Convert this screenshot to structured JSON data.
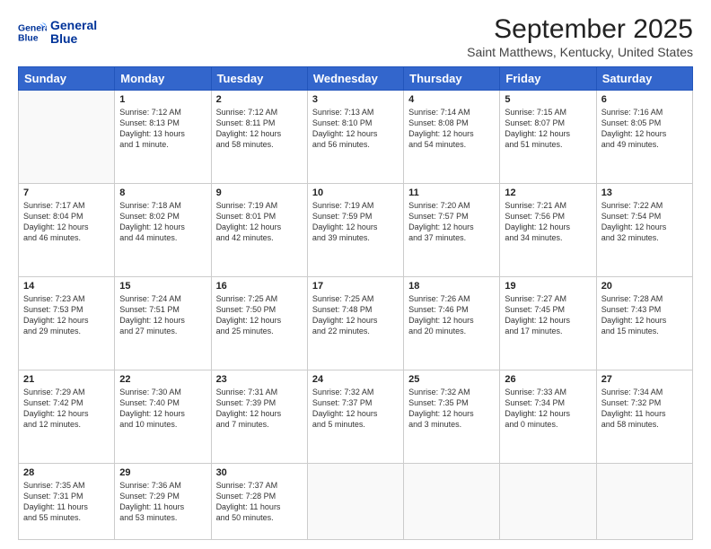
{
  "header": {
    "logo_line1": "General",
    "logo_line2": "Blue",
    "title": "September 2025",
    "subtitle": "Saint Matthews, Kentucky, United States"
  },
  "days_of_week": [
    "Sunday",
    "Monday",
    "Tuesday",
    "Wednesday",
    "Thursday",
    "Friday",
    "Saturday"
  ],
  "weeks": [
    [
      {
        "day": "",
        "lines": []
      },
      {
        "day": "1",
        "lines": [
          "Sunrise: 7:12 AM",
          "Sunset: 8:13 PM",
          "Daylight: 13 hours",
          "and 1 minute."
        ]
      },
      {
        "day": "2",
        "lines": [
          "Sunrise: 7:12 AM",
          "Sunset: 8:11 PM",
          "Daylight: 12 hours",
          "and 58 minutes."
        ]
      },
      {
        "day": "3",
        "lines": [
          "Sunrise: 7:13 AM",
          "Sunset: 8:10 PM",
          "Daylight: 12 hours",
          "and 56 minutes."
        ]
      },
      {
        "day": "4",
        "lines": [
          "Sunrise: 7:14 AM",
          "Sunset: 8:08 PM",
          "Daylight: 12 hours",
          "and 54 minutes."
        ]
      },
      {
        "day": "5",
        "lines": [
          "Sunrise: 7:15 AM",
          "Sunset: 8:07 PM",
          "Daylight: 12 hours",
          "and 51 minutes."
        ]
      },
      {
        "day": "6",
        "lines": [
          "Sunrise: 7:16 AM",
          "Sunset: 8:05 PM",
          "Daylight: 12 hours",
          "and 49 minutes."
        ]
      }
    ],
    [
      {
        "day": "7",
        "lines": [
          "Sunrise: 7:17 AM",
          "Sunset: 8:04 PM",
          "Daylight: 12 hours",
          "and 46 minutes."
        ]
      },
      {
        "day": "8",
        "lines": [
          "Sunrise: 7:18 AM",
          "Sunset: 8:02 PM",
          "Daylight: 12 hours",
          "and 44 minutes."
        ]
      },
      {
        "day": "9",
        "lines": [
          "Sunrise: 7:19 AM",
          "Sunset: 8:01 PM",
          "Daylight: 12 hours",
          "and 42 minutes."
        ]
      },
      {
        "day": "10",
        "lines": [
          "Sunrise: 7:19 AM",
          "Sunset: 7:59 PM",
          "Daylight: 12 hours",
          "and 39 minutes."
        ]
      },
      {
        "day": "11",
        "lines": [
          "Sunrise: 7:20 AM",
          "Sunset: 7:57 PM",
          "Daylight: 12 hours",
          "and 37 minutes."
        ]
      },
      {
        "day": "12",
        "lines": [
          "Sunrise: 7:21 AM",
          "Sunset: 7:56 PM",
          "Daylight: 12 hours",
          "and 34 minutes."
        ]
      },
      {
        "day": "13",
        "lines": [
          "Sunrise: 7:22 AM",
          "Sunset: 7:54 PM",
          "Daylight: 12 hours",
          "and 32 minutes."
        ]
      }
    ],
    [
      {
        "day": "14",
        "lines": [
          "Sunrise: 7:23 AM",
          "Sunset: 7:53 PM",
          "Daylight: 12 hours",
          "and 29 minutes."
        ]
      },
      {
        "day": "15",
        "lines": [
          "Sunrise: 7:24 AM",
          "Sunset: 7:51 PM",
          "Daylight: 12 hours",
          "and 27 minutes."
        ]
      },
      {
        "day": "16",
        "lines": [
          "Sunrise: 7:25 AM",
          "Sunset: 7:50 PM",
          "Daylight: 12 hours",
          "and 25 minutes."
        ]
      },
      {
        "day": "17",
        "lines": [
          "Sunrise: 7:25 AM",
          "Sunset: 7:48 PM",
          "Daylight: 12 hours",
          "and 22 minutes."
        ]
      },
      {
        "day": "18",
        "lines": [
          "Sunrise: 7:26 AM",
          "Sunset: 7:46 PM",
          "Daylight: 12 hours",
          "and 20 minutes."
        ]
      },
      {
        "day": "19",
        "lines": [
          "Sunrise: 7:27 AM",
          "Sunset: 7:45 PM",
          "Daylight: 12 hours",
          "and 17 minutes."
        ]
      },
      {
        "day": "20",
        "lines": [
          "Sunrise: 7:28 AM",
          "Sunset: 7:43 PM",
          "Daylight: 12 hours",
          "and 15 minutes."
        ]
      }
    ],
    [
      {
        "day": "21",
        "lines": [
          "Sunrise: 7:29 AM",
          "Sunset: 7:42 PM",
          "Daylight: 12 hours",
          "and 12 minutes."
        ]
      },
      {
        "day": "22",
        "lines": [
          "Sunrise: 7:30 AM",
          "Sunset: 7:40 PM",
          "Daylight: 12 hours",
          "and 10 minutes."
        ]
      },
      {
        "day": "23",
        "lines": [
          "Sunrise: 7:31 AM",
          "Sunset: 7:39 PM",
          "Daylight: 12 hours",
          "and 7 minutes."
        ]
      },
      {
        "day": "24",
        "lines": [
          "Sunrise: 7:32 AM",
          "Sunset: 7:37 PM",
          "Daylight: 12 hours",
          "and 5 minutes."
        ]
      },
      {
        "day": "25",
        "lines": [
          "Sunrise: 7:32 AM",
          "Sunset: 7:35 PM",
          "Daylight: 12 hours",
          "and 3 minutes."
        ]
      },
      {
        "day": "26",
        "lines": [
          "Sunrise: 7:33 AM",
          "Sunset: 7:34 PM",
          "Daylight: 12 hours",
          "and 0 minutes."
        ]
      },
      {
        "day": "27",
        "lines": [
          "Sunrise: 7:34 AM",
          "Sunset: 7:32 PM",
          "Daylight: 11 hours",
          "and 58 minutes."
        ]
      }
    ],
    [
      {
        "day": "28",
        "lines": [
          "Sunrise: 7:35 AM",
          "Sunset: 7:31 PM",
          "Daylight: 11 hours",
          "and 55 minutes."
        ]
      },
      {
        "day": "29",
        "lines": [
          "Sunrise: 7:36 AM",
          "Sunset: 7:29 PM",
          "Daylight: 11 hours",
          "and 53 minutes."
        ]
      },
      {
        "day": "30",
        "lines": [
          "Sunrise: 7:37 AM",
          "Sunset: 7:28 PM",
          "Daylight: 11 hours",
          "and 50 minutes."
        ]
      },
      {
        "day": "",
        "lines": []
      },
      {
        "day": "",
        "lines": []
      },
      {
        "day": "",
        "lines": []
      },
      {
        "day": "",
        "lines": []
      }
    ]
  ]
}
